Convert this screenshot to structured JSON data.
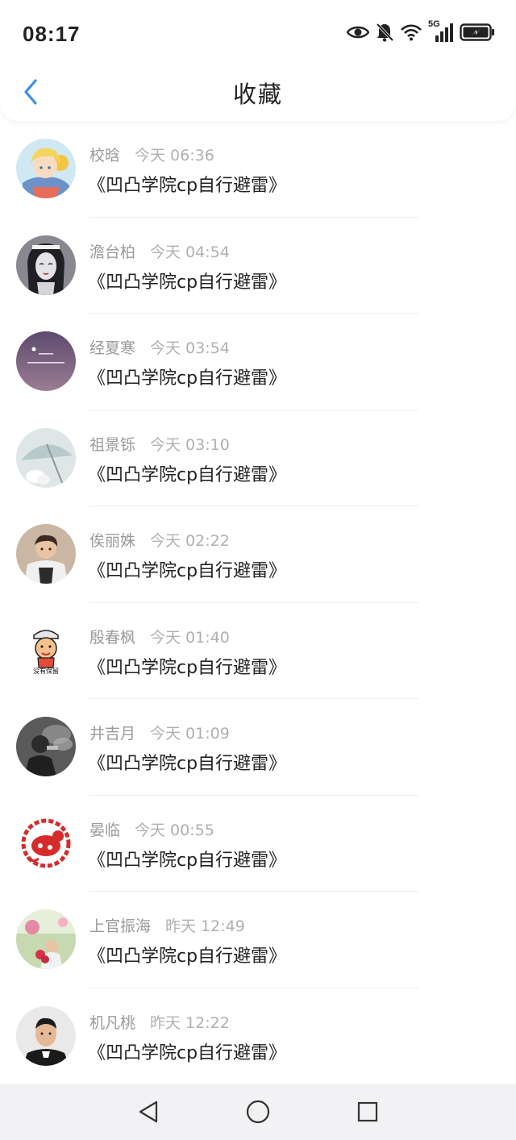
{
  "status_bar": {
    "time": "08:17",
    "network": "5G",
    "icons": [
      "eye-icon",
      "bell-muted-icon",
      "wifi-icon",
      "signal-icon",
      "battery-charging-icon"
    ]
  },
  "header": {
    "title": "收藏",
    "back_icon": "chevron-left-icon",
    "accent_color": "#3b8fe8"
  },
  "items": [
    {
      "name": "校晗",
      "time": "今天 06:36",
      "title": "《凹凸学院cp自行避雷》",
      "avatar": "avatar-anime-boy"
    },
    {
      "name": "澹台柏",
      "time": "今天 04:54",
      "title": "《凹凸学院cp自行避雷》",
      "avatar": "avatar-anime-girl"
    },
    {
      "name": "经夏寒",
      "time": "今天 03:54",
      "title": "《凹凸学院cp自行避雷》",
      "avatar": "avatar-purple-text"
    },
    {
      "name": "祖景铄",
      "time": "今天 03:10",
      "title": "《凹凸学院cp自行避雷》",
      "avatar": "avatar-umbrella"
    },
    {
      "name": "俟丽姝",
      "time": "今天 02:22",
      "title": "《凹凸学院cp自行避雷》",
      "avatar": "avatar-person"
    },
    {
      "name": "殷春枫",
      "time": "今天 01:40",
      "title": "《凹凸学院cp自行避雷》",
      "avatar": "avatar-cartoon",
      "avatar_caption": "没有保留"
    },
    {
      "name": "井吉月",
      "time": "今天 01:09",
      "title": "《凹凸学院cp自行避雷》",
      "avatar": "avatar-smoke"
    },
    {
      "name": "晏临",
      "time": "今天 00:55",
      "title": "《凹凸学院cp自行避雷》",
      "avatar": "avatar-papercut"
    },
    {
      "name": "上官振海",
      "time": "昨天 12:49",
      "title": "《凹凸学院cp自行避雷》",
      "avatar": "avatar-flowers"
    },
    {
      "name": "机凡桃",
      "time": "昨天 12:22",
      "title": "《凹凸学院cp自行避雷》",
      "avatar": "avatar-man"
    }
  ],
  "system_nav": {
    "back": "back-triangle-icon",
    "home": "home-circle-icon",
    "recents": "recents-square-icon"
  }
}
